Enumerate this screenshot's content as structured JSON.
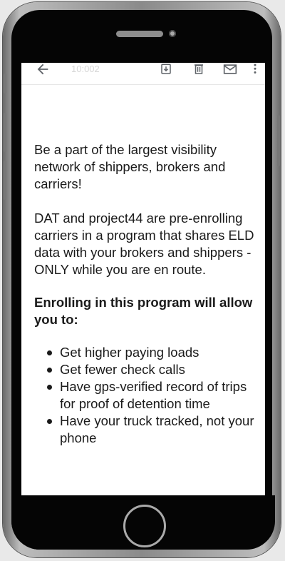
{
  "toolbar": {
    "subject_faded": "10:002",
    "icons": [
      "back-arrow-icon",
      "archive-icon",
      "delete-icon",
      "mail-icon",
      "more-vertical-icon"
    ]
  },
  "email": {
    "intro": "Be a part of the largest visibility network of shippers, brokers and carriers!",
    "body": "DAT and project44 are pre-enrolling carriers in a program that shares ELD data with your brokers and shippers - ONLY while you are en route.",
    "benefits_heading": "Enrolling in this program will allow you to:",
    "benefits": [
      "Get higher paying loads",
      "Get fewer check calls",
      "Have gps-verified record of trips for proof of detention time",
      "Have your truck tracked, not your phone"
    ]
  },
  "colors": {
    "phone_bezel": "#050505",
    "frame_silver": "#bdbdbd",
    "text": "#1a1a1a",
    "icon_gray": "#5f6368"
  }
}
